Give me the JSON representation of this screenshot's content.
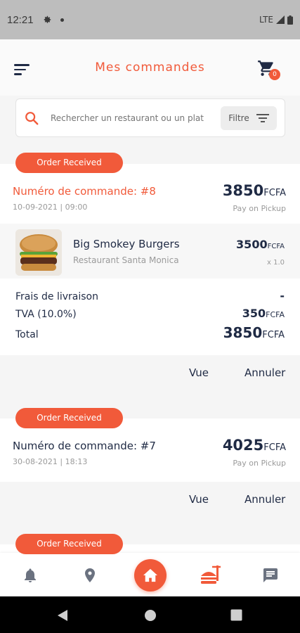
{
  "status_bar": {
    "time": "12:21",
    "network": "LTE"
  },
  "header": {
    "title": "Mes commandes",
    "cart_count": "0"
  },
  "search": {
    "placeholder": "Rechercher un restaurant ou un plat",
    "filter_label": "Filtre"
  },
  "orders": [
    {
      "status": "Order Received",
      "number": "Numéro de commande: #8",
      "date": "10-09-2021 | 09:00",
      "total": "3850",
      "currency": "FCFA",
      "payment": "Pay on Pickup",
      "items": [
        {
          "name": "Big Smokey Burgers",
          "restaurant": "Restaurant Santa Monica",
          "price": "3500",
          "currency": "FCFA",
          "qty": "x 1.0"
        }
      ],
      "summary": {
        "delivery_label": "Frais de livraison",
        "delivery_value": "-",
        "tax_label": "TVA (10.0%)",
        "tax_value": "350",
        "tax_currency": "FCFA",
        "total_label": "Total",
        "total_value": "3850",
        "total_currency": "FCFA"
      },
      "actions": {
        "view": "Vue",
        "cancel": "Annuler"
      }
    },
    {
      "status": "Order Received",
      "number": "Numéro de commande: #7",
      "date": "30-08-2021 | 18:13",
      "total": "4025",
      "currency": "FCFA",
      "payment": "Pay on Pickup",
      "actions": {
        "view": "Vue",
        "cancel": "Annuler"
      }
    },
    {
      "status": "Order Received"
    }
  ],
  "bottom_nav": {
    "items": [
      "bell-icon",
      "location-pin-icon",
      "home-icon",
      "food-icon",
      "chat-icon"
    ],
    "active": "food-icon"
  },
  "colors": {
    "accent": "#f15a3a",
    "text": "#1f2a44",
    "muted": "#9a9a9a"
  }
}
